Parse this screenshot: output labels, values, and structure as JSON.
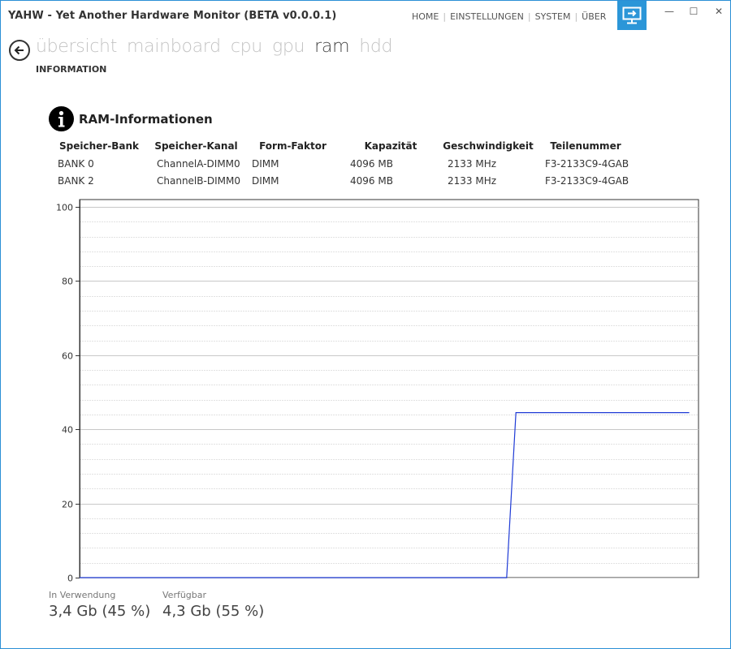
{
  "window": {
    "title": "YAHW - Yet Another Hardware Monitor (BETA v0.0.0.1)",
    "controls": {
      "minimize": "—",
      "maximize": "☐",
      "close": "✕"
    }
  },
  "topnav": [
    "HOME",
    "EINSTELLUNGEN",
    "SYSTEM",
    "ÜBER"
  ],
  "tabs": [
    {
      "label": "übersicht",
      "active": false
    },
    {
      "label": "mainboard",
      "active": false
    },
    {
      "label": "cpu",
      "active": false
    },
    {
      "label": "gpu",
      "active": false
    },
    {
      "label": "ram",
      "active": true
    },
    {
      "label": "hdd",
      "active": false
    }
  ],
  "subtab": "INFORMATION",
  "section": {
    "title": "RAM-Informationen",
    "icon": "info-icon"
  },
  "table": {
    "headers": [
      "Speicher-Bank",
      "Speicher-Kanal",
      "Form-Faktor",
      "Kapazität",
      "Geschwindigkeit",
      "Teilenummer"
    ],
    "rows": [
      [
        "BANK 0",
        "ChannelA-DIMM0",
        "DIMM",
        "4096 MB",
        "2133 MHz",
        "F3-2133C9-4GAB"
      ],
      [
        "BANK 2",
        "ChannelB-DIMM0",
        "DIMM",
        "4096 MB",
        "2133 MHz",
        "F3-2133C9-4GAB"
      ]
    ]
  },
  "chart_data": {
    "type": "line",
    "ylim": [
      0,
      100
    ],
    "yticks": [
      0,
      20,
      40,
      60,
      80,
      100
    ],
    "xlim": [
      0,
      100
    ],
    "grid": true,
    "series": [
      {
        "color": "#1f3bd6",
        "x": [
          0,
          69,
          70.5,
          98.5
        ],
        "y": [
          0,
          0,
          44.5,
          44.5
        ]
      }
    ]
  },
  "legend": [
    {
      "label": "In Verwendung",
      "value": "3,4 Gb (45 %)"
    },
    {
      "label": "Verfügbar",
      "value": "4,3 Gb (55 %)"
    }
  ],
  "colors": {
    "accent": "#2b96d8",
    "window_border": "#2b8fd6",
    "inactive_tab": "#c3c3c3"
  }
}
